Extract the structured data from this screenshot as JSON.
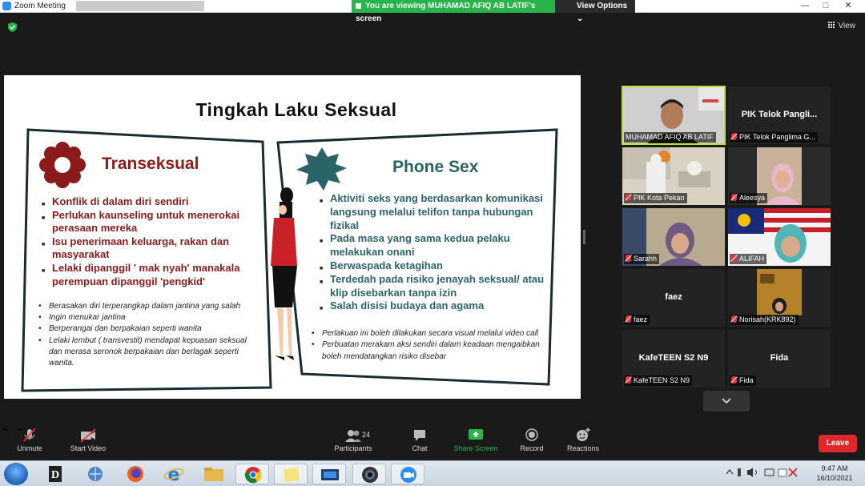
{
  "window": {
    "app_title": "Zoom Meeting",
    "sharing_banner": "You are viewing MUHAMAD AFIQ AB LATIF's screen",
    "view_options": "View Options",
    "minimize": "—",
    "maximize": "□",
    "close": "✕"
  },
  "view_button": "View",
  "slide": {
    "title": "Tingkah Laku Seksual",
    "left": {
      "heading": "Transeksual",
      "bullets": [
        "Konflik di dalam diri sendiri",
        "Perlukan kaunseling untuk menerokai perasaan mereka",
        "Isu penerimaan keluarga, rakan dan masyarakat",
        "Lelaki dipanggil ' mak nyah' manakala perempuan dipanggil 'pengkid'"
      ],
      "notes": [
        "Berasakan diri terperangkap dalam jantina yang salah",
        "Ingin menukar jantina",
        "Berperangai dan berpakaian seperti wanita",
        "Lelaki lembut ( transvestit) mendapat kepuasan seksual dan merasa seronok berpakaian dan berlagak seperti wanita."
      ]
    },
    "right": {
      "heading": "Phone Sex",
      "bullets": [
        "Aktiviti seks yang berdasarkan komunikasi langsung melalui telifon tanpa hubungan fizikal",
        "Pada masa yang sama kedua pelaku melakukan onani",
        "Berwaspada ketagihan",
        "Terdedah pada risiko jenayah seksual/ atau klip disebarkan tanpa izin",
        "Salah disisi budaya dan agama"
      ],
      "notes": [
        "Perlakuan ini boleh dilakukan secara visual melalui video call",
        "Perbuatan merakam aksi sendiri dalam keadaan mengaibkan boleh mendatangkan risiko disebar"
      ]
    }
  },
  "participants_gallery": [
    {
      "name": "MUHAMAD AFIQ AB LATIF",
      "muted": false,
      "video": true,
      "active": true
    },
    {
      "name": "PIK Telok Panglima G...",
      "display": "PIK Telok Pangli...",
      "muted": true,
      "video": false
    },
    {
      "name": "PIK Kota Pekan",
      "muted": true,
      "video": true
    },
    {
      "name": "Aleesya",
      "muted": true,
      "video": true
    },
    {
      "name": "Sarahh",
      "muted": true,
      "video": true
    },
    {
      "name": "ALIFAH",
      "muted": true,
      "video": true
    },
    {
      "name": "faez",
      "display": "faez",
      "muted": true,
      "video": false
    },
    {
      "name": "Norisah(KRK892)",
      "muted": true,
      "video": true
    },
    {
      "name": "KafeTEEN S2 N9",
      "display": "KafeTEEN S2 N9",
      "muted": true,
      "video": false
    },
    {
      "name": "Fida",
      "display": "Fida",
      "muted": true,
      "video": false
    }
  ],
  "toolbar": {
    "unmute": "Unmute",
    "start_video": "Start Video",
    "participants": "Participants",
    "participants_count": "24",
    "chat": "Chat",
    "share_screen": "Share Screen",
    "record": "Record",
    "reactions": "Reactions",
    "leave": "Leave"
  },
  "taskbar": {
    "time": "9:47 AM",
    "date": "16/10/2021"
  },
  "colors": {
    "share_green": "#27b54a",
    "leave_red": "#e02828",
    "active_speaker": "#b8e23b",
    "slide_red": "#8b1a1a",
    "slide_teal": "#2a6469"
  }
}
